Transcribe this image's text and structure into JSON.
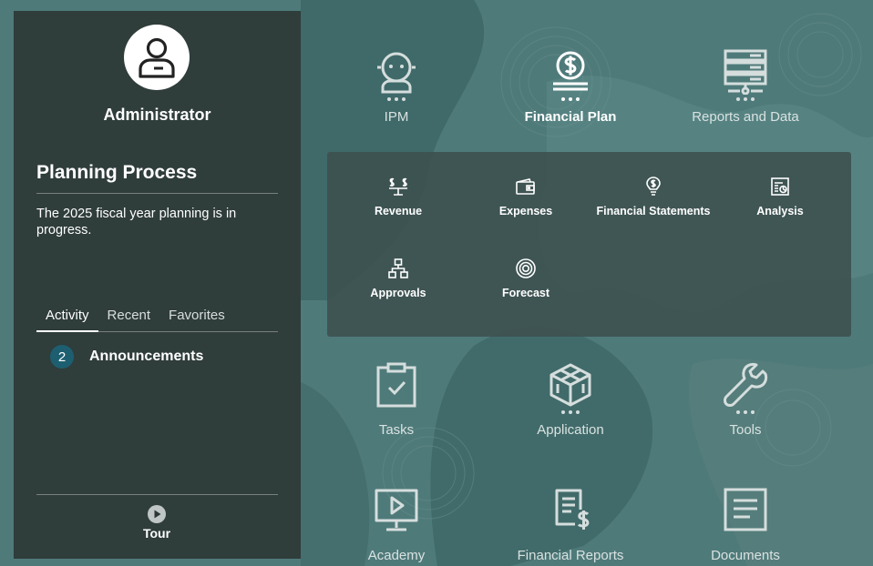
{
  "user": {
    "name": "Administrator",
    "icon": "user-icon"
  },
  "planning": {
    "title": "Planning Process",
    "message": "The 2025 fiscal year planning is in progress."
  },
  "tabs": [
    {
      "label": "Activity",
      "active": true
    },
    {
      "label": "Recent",
      "active": false
    },
    {
      "label": "Favorites",
      "active": false
    }
  ],
  "announcements": {
    "count": "2",
    "label": "Announcements"
  },
  "tour": {
    "label": "Tour",
    "icon": "play-icon"
  },
  "nav": {
    "ipm": {
      "label": "IPM",
      "icon": "robot-icon"
    },
    "financial_plan": {
      "label": "Financial Plan",
      "icon": "dollar-icon"
    },
    "reports_data": {
      "label": "Reports and Data",
      "icon": "server-icon"
    },
    "tasks": {
      "label": "Tasks",
      "icon": "clipboard-check-icon"
    },
    "application": {
      "label": "Application",
      "icon": "cube-icon"
    },
    "tools": {
      "label": "Tools",
      "icon": "wrench-icon"
    },
    "academy": {
      "label": "Academy",
      "icon": "monitor-play-icon"
    },
    "financial_reports": {
      "label": "Financial Reports",
      "icon": "report-dollar-icon"
    },
    "documents": {
      "label": "Documents",
      "icon": "document-icon"
    }
  },
  "financial_plan_items": {
    "revenue": {
      "label": "Revenue",
      "icon": "scale-dollar-icon"
    },
    "expenses": {
      "label": "Expenses",
      "icon": "wallet-icon"
    },
    "financial_statements": {
      "label": "Financial Statements",
      "icon": "lightbulb-icon"
    },
    "analysis": {
      "label": "Analysis",
      "icon": "chart-icon"
    },
    "approvals": {
      "label": "Approvals",
      "icon": "hierarchy-icon"
    },
    "forecast": {
      "label": "Forecast",
      "icon": "target-icon"
    }
  },
  "colors": {
    "background": "#4f7a7a",
    "panel": "#2c3735",
    "accent_badge": "#1d5f71"
  }
}
